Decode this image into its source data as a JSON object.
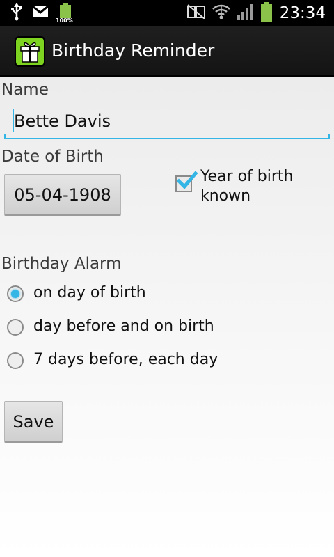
{
  "status_bar": {
    "time": "23:34",
    "battery_small_pct": "100%",
    "icons": [
      "usb-icon",
      "gmail-icon",
      "battery-full-icon",
      "nfc-icon",
      "wifi-icon",
      "signal-icon",
      "battery-icon"
    ],
    "battery_color": "#8bc34a"
  },
  "action_bar": {
    "title": "Birthday Reminder",
    "icon": "gift-icon",
    "icon_color": "#7ed321"
  },
  "form": {
    "name_label": "Name",
    "name_value": "Bette Davis",
    "dob_label": "Date of Birth",
    "dob_value": "05-04-1908",
    "year_known_label": "Year of birth known",
    "year_known_checked": true,
    "alarm_label": "Birthday Alarm",
    "alarm_options": [
      {
        "label": "on day of birth",
        "selected": true
      },
      {
        "label": "day before and on birth",
        "selected": false
      },
      {
        "label": "7 days before, each day",
        "selected": false
      }
    ],
    "save_label": "Save"
  },
  "colors": {
    "accent": "#33b5e5",
    "actionbar_bg": "#1b1b1b",
    "statusbar_bg": "#000000"
  }
}
